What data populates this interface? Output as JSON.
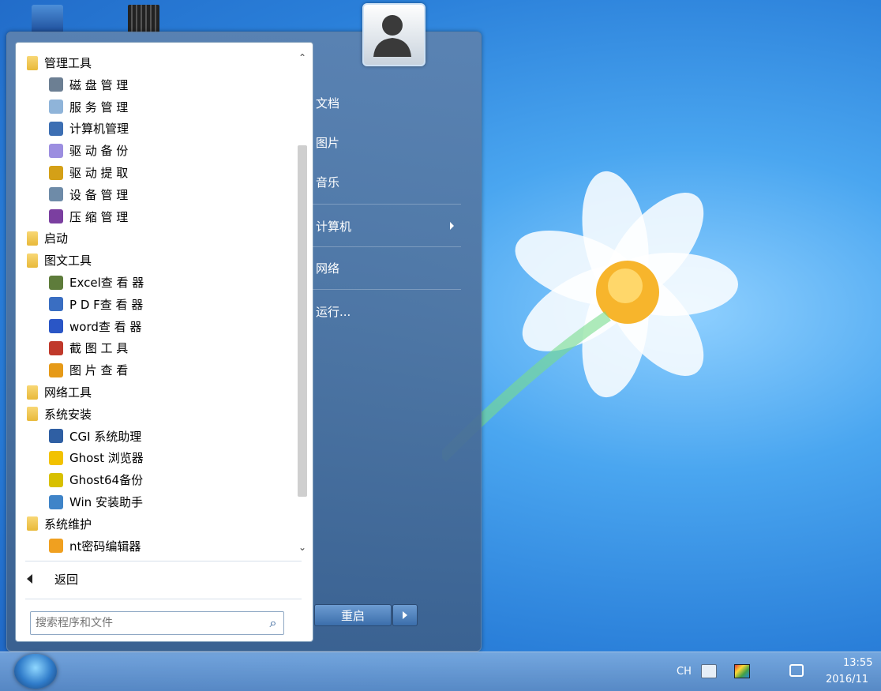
{
  "programs": {
    "items": [
      {
        "label": "管理工具",
        "icon": "folder-icon",
        "indent": 0
      },
      {
        "label": "磁 盘 管 理",
        "icon": "disk-icon",
        "indent": 1
      },
      {
        "label": "服 务 管 理",
        "icon": "gear-icon",
        "indent": 1
      },
      {
        "label": "计算机管理",
        "icon": "computer-icon",
        "indent": 1
      },
      {
        "label": "驱 动 备 份",
        "icon": "driver-backup-icon",
        "indent": 1
      },
      {
        "label": "驱 动 提 取",
        "icon": "driver-extract-icon",
        "indent": 1
      },
      {
        "label": "设 备 管 理",
        "icon": "device-icon",
        "indent": 1
      },
      {
        "label": "压 缩 管 理",
        "icon": "archive-icon",
        "indent": 1
      },
      {
        "label": "启动",
        "icon": "folder-icon",
        "indent": 0
      },
      {
        "label": "图文工具",
        "icon": "folder-icon",
        "indent": 0
      },
      {
        "label": "Excel查 看 器",
        "icon": "excel-icon",
        "indent": 1
      },
      {
        "label": "P D F查 看 器",
        "icon": "pdf-icon",
        "indent": 1
      },
      {
        "label": "word查 看 器",
        "icon": "word-icon",
        "indent": 1
      },
      {
        "label": "截 图 工 具",
        "icon": "screenshot-icon",
        "indent": 1
      },
      {
        "label": "图 片 查 看",
        "icon": "image-viewer-icon",
        "indent": 1
      },
      {
        "label": "网络工具",
        "icon": "folder-icon",
        "indent": 0
      },
      {
        "label": "系统安装",
        "icon": "folder-icon",
        "indent": 0
      },
      {
        "label": "CGI 系统助理",
        "icon": "cgi-icon",
        "indent": 1
      },
      {
        "label": "Ghost 浏览器",
        "icon": "ghost-icon",
        "indent": 1
      },
      {
        "label": "Ghost64备份",
        "icon": "ghost64-icon",
        "indent": 1
      },
      {
        "label": "Win 安装助手",
        "icon": "win-install-icon",
        "indent": 1
      },
      {
        "label": "系统维护",
        "icon": "folder-icon",
        "indent": 0
      },
      {
        "label": "nt密码编辑器",
        "icon": "key-icon",
        "indent": 1
      }
    ]
  },
  "back_label": "返回",
  "search": {
    "placeholder": "搜索程序和文件"
  },
  "right": {
    "documents": "文档",
    "pictures": "图片",
    "music": "音乐",
    "computer": "计算机",
    "network": "网络",
    "run": "运行..."
  },
  "restart_label": "重启",
  "tray": {
    "lang": "CH",
    "time": "13:55",
    "date": "2016/11"
  },
  "colors": {
    "folder": "#e8b93a",
    "accent": "#3b6eab"
  }
}
